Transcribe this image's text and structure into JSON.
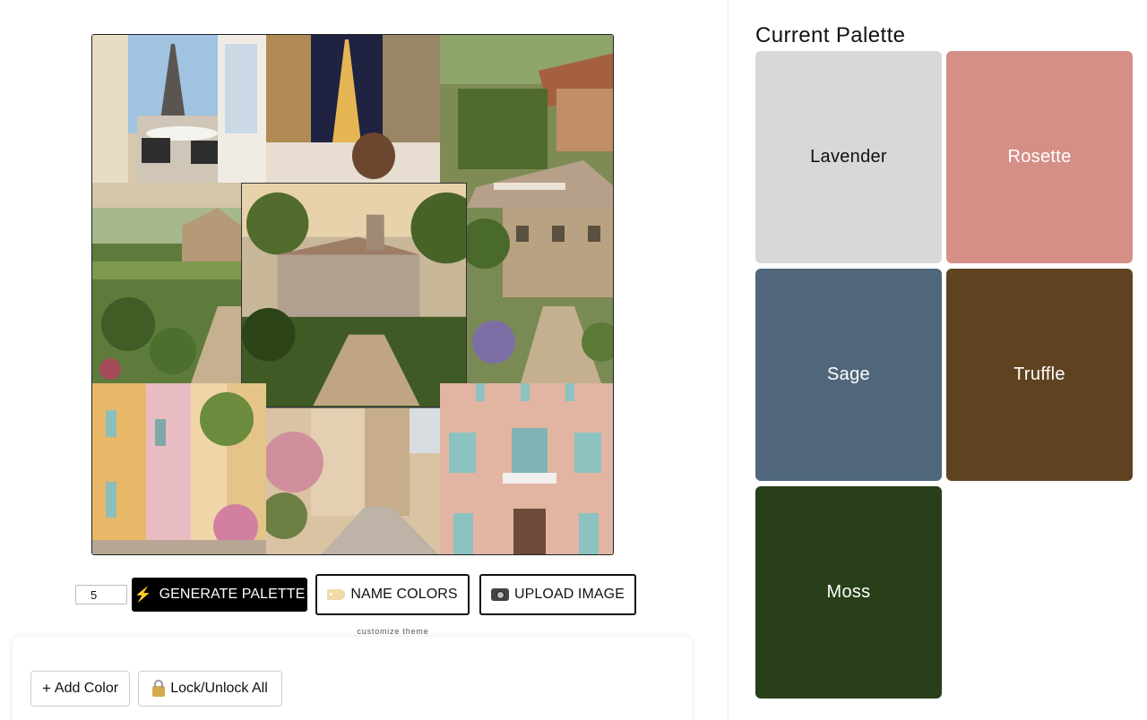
{
  "controls": {
    "count_value": "5",
    "generate_label": "GENERATE PALETTE",
    "name_colors_label": "NAME COLORS",
    "upload_label": "UPLOAD IMAGE",
    "customize_label": "customize theme"
  },
  "toolbar": {
    "add_color_label": "Add Color",
    "lock_all_label": "Lock/Unlock All"
  },
  "palette": {
    "title": "Current Palette",
    "swatches": [
      {
        "name": "Lavender",
        "color": "#d9d7d9",
        "text_color": "#111111"
      },
      {
        "name": "Rosette",
        "color": "#d58f87",
        "text_color": "#ffffff"
      },
      {
        "name": "Sage",
        "color": "#50677b",
        "text_color": "#ffffff"
      },
      {
        "name": "Truffle",
        "color": "#5f4320",
        "text_color": "#ffffff"
      },
      {
        "name": "Moss",
        "color": "#283f19",
        "text_color": "#ffffff"
      }
    ]
  },
  "icons": {
    "generate": "lightning-icon",
    "name_colors": "label-tag-icon",
    "upload": "camera-icon",
    "add": "plus-icon",
    "lock": "lock-icon"
  }
}
